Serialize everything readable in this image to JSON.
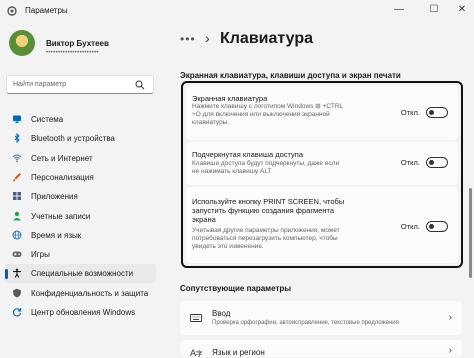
{
  "window": {
    "title": "Параметры",
    "minimize": "—",
    "maximize": "☐",
    "close": "✕"
  },
  "user": {
    "name": "Виктор Бухтеев",
    "email": "••••••••••••••••••••••"
  },
  "search": {
    "placeholder": "Найти параметр"
  },
  "sidebar": {
    "items": [
      {
        "label": "Система",
        "icon": "monitor-icon",
        "color": "#0067c0"
      },
      {
        "label": "Bluetooth и устройства",
        "icon": "bluetooth-icon",
        "color": "#0067c0"
      },
      {
        "label": "Сеть и Интернет",
        "icon": "network-icon",
        "color": "#3a6ea5"
      },
      {
        "label": "Персонализация",
        "icon": "brush-icon",
        "color": "#c06020"
      },
      {
        "label": "Приложения",
        "icon": "apps-icon",
        "color": "#4a5a8a"
      },
      {
        "label": "Учетные записи",
        "icon": "person-icon",
        "color": "#2a9d5a"
      },
      {
        "label": "Время и язык",
        "icon": "globe-icon",
        "color": "#2a7ac0"
      },
      {
        "label": "Игры",
        "icon": "gamepad-icon",
        "color": "#6a6a6a"
      },
      {
        "label": "Специальные возможности",
        "icon": "accessibility-icon",
        "color": "#1b1b1b"
      },
      {
        "label": "Конфиденциальность и защита",
        "icon": "shield-icon",
        "color": "#5a5a5a"
      },
      {
        "label": "Центр обновления Windows",
        "icon": "update-icon",
        "color": "#0067c0"
      }
    ],
    "active_index": 8
  },
  "breadcrumb": {
    "dots": "•••",
    "chevron": "›",
    "title": "Клавиатура"
  },
  "section": {
    "heading": "Экранная клавиатура, клавиши доступа и экран печати"
  },
  "cards": [
    {
      "title": "Экранная клавиатура",
      "desc": "Нажмите клавишу с логотипом Windows ⊞ +CTRL\n+O для включения или выключения экранной\nклавиатуры.",
      "state": "Откл."
    },
    {
      "title": "Подчеркнутая клавиша доступа",
      "desc": "Клавиши доступа будут подчеркнуты, даже если\nне нажимать клавишу ALT",
      "state": "Откл."
    },
    {
      "title": "Используйте кнопку PRINT SCREEN, чтобы\nзапустить функцию создания фрагмента\nэкрана",
      "desc": "Учитывая другие параметры приложения, может\nпотребоваться перезагрузить компьютер, чтобы\nувидеть это изменение.",
      "state": "Откл."
    }
  ],
  "related": {
    "heading": "Сопутствующие параметры",
    "items": [
      {
        "title": "Ввод",
        "subtitle": "Проверка орфографии, автоисправление, текстовые предложения",
        "icon": "keyboard-icon"
      },
      {
        "title": "Язык и регион",
        "subtitle": "",
        "icon": "language-icon"
      }
    ]
  },
  "colors": {
    "accent": "#005fb8",
    "highlight_border": "#111111"
  }
}
